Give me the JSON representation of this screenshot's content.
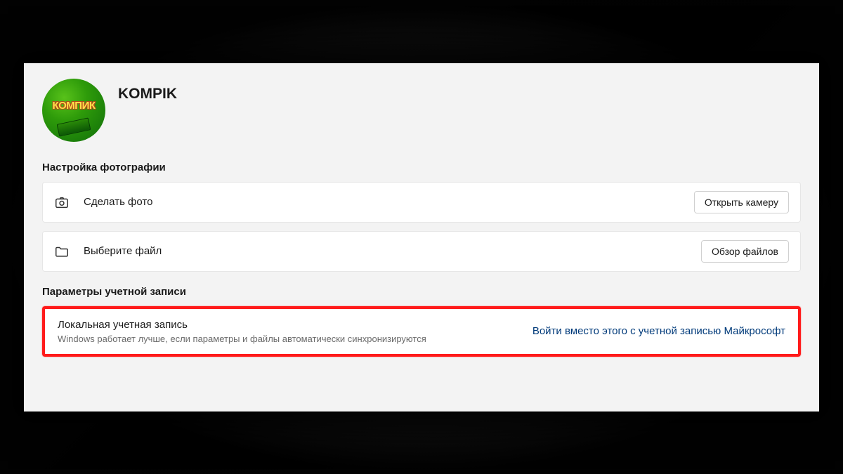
{
  "profile": {
    "avatar_text": "КОМПИК",
    "username": "KOMPIK"
  },
  "photo_section": {
    "title": "Настройка фотографии",
    "rows": [
      {
        "icon": "camera-icon",
        "label": "Сделать фото",
        "button": "Открыть камеру"
      },
      {
        "icon": "folder-icon",
        "label": "Выберите файл",
        "button": "Обзор файлов"
      }
    ]
  },
  "account_section": {
    "title": "Параметры учетной записи",
    "card": {
      "title": "Локальная учетная запись",
      "subtitle": "Windows работает лучше, если параметры и файлы автоматически синхронизируются",
      "link": "Войти вместо этого с учетной записью Майкрософт"
    }
  }
}
